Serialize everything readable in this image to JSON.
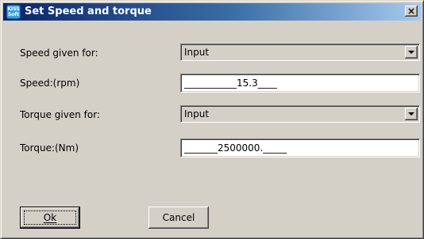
{
  "window": {
    "title": "Set Speed and torque",
    "icon": "kisssoft-app-icon",
    "icon_text": "KISS\nSoft",
    "close_label": "×"
  },
  "form": {
    "speed_given_for": {
      "label": "Speed given for:",
      "value": "Input"
    },
    "speed": {
      "label": "Speed:(rpm)",
      "value": "___________15.3____"
    },
    "torque_given_for": {
      "label": "Torque given for:",
      "value": "Input"
    },
    "torque": {
      "label": "Torque:(Nm)",
      "value": "_______2500000._____"
    }
  },
  "buttons": {
    "ok_label": "Ok",
    "cancel_label": "Cancel"
  },
  "colors": {
    "title_gradient_start": "#0a246a",
    "title_gradient_end": "#a6caf0",
    "face": "#d4d0c8"
  }
}
